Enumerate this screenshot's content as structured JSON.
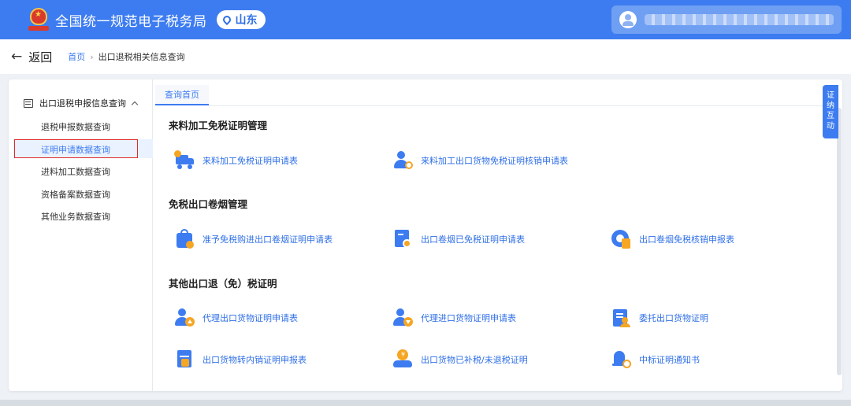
{
  "header": {
    "site_title": "全国统一规范电子税务局",
    "region": "山东"
  },
  "breadcrumb": {
    "back_label": "返回",
    "home": "首页",
    "separator": "›",
    "current": "出口退税相关信息查询"
  },
  "sidebar": {
    "group_label": "出口退税申报信息查询",
    "items": [
      {
        "label": "退税申报数据查询"
      },
      {
        "label": "证明申请数据查询"
      },
      {
        "label": "进料加工数据查询"
      },
      {
        "label": "资格备案数据查询"
      },
      {
        "label": "其他业务数据查询"
      }
    ],
    "active_index": 1
  },
  "tab": {
    "label": "查询首页"
  },
  "float_tab": {
    "chars": [
      "证",
      "纳",
      "互",
      "动"
    ]
  },
  "sections": [
    {
      "title": "来料加工免税证明管理",
      "links": [
        {
          "label": "来料加工免税证明申请表",
          "icon": "truck-icon"
        },
        {
          "label": "来料加工出口货物免税证明核销申请表",
          "icon": "user-gear-icon"
        }
      ]
    },
    {
      "title": "免税出口卷烟管理",
      "links": [
        {
          "label": "准予免税购进出口卷烟证明申请表",
          "icon": "bag-check-icon"
        },
        {
          "label": "出口卷烟已免税证明申请表",
          "icon": "doc-user-icon"
        },
        {
          "label": "出口卷烟免税核销申报表",
          "icon": "gear-doc-icon"
        }
      ]
    },
    {
      "title": "其他出口退（免）税证明",
      "links": [
        {
          "label": "代理出口货物证明申请表",
          "icon": "user-up-icon"
        },
        {
          "label": "代理进口货物证明申请表",
          "icon": "user-down-icon"
        },
        {
          "label": "委托出口货物证明",
          "icon": "clipboard-user-icon"
        },
        {
          "label": "出口货物转内销证明申报表",
          "icon": "doc-swap-icon"
        },
        {
          "label": "出口货物已补税/未退税证明",
          "icon": "hand-coin-icon"
        },
        {
          "label": "中标证明通知书",
          "icon": "bell-gear-icon"
        }
      ]
    }
  ],
  "colors": {
    "brand_blue": "#3d7cf0",
    "accent_orange": "#f5a623",
    "highlight_red": "#e0292b"
  }
}
